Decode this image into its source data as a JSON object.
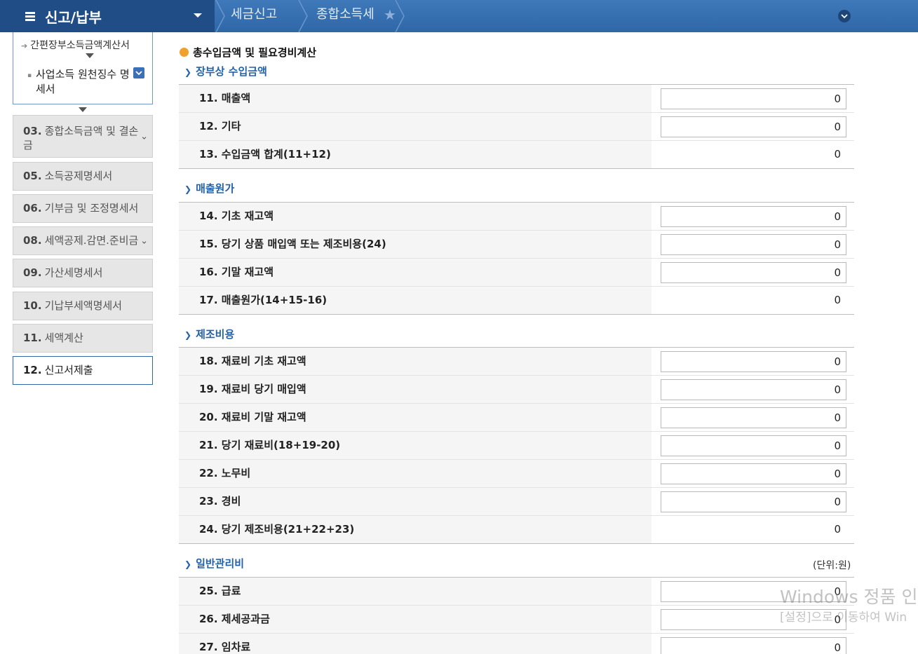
{
  "header": {
    "menu_title": "신고/납부",
    "breadcrumbs": [
      "세금신고",
      "종합소득세"
    ]
  },
  "sidebar": {
    "sub_items": [
      "간편장부소득금액계산서",
      "사업소득 원천징수 명세서"
    ],
    "nav": [
      {
        "num": "03.",
        "label": "종합소득금액 및 결손금"
      },
      {
        "num": "05.",
        "label": "소득공제명세서"
      },
      {
        "num": "06.",
        "label": "기부금 및 조정명세서"
      },
      {
        "num": "08.",
        "label": "세액공제.감면.준비금"
      },
      {
        "num": "09.",
        "label": "가산세명세서"
      },
      {
        "num": "10.",
        "label": "기납부세액명세서"
      },
      {
        "num": "11.",
        "label": "세액계산"
      },
      {
        "num": "12.",
        "label": "신고서제출"
      }
    ]
  },
  "main": {
    "title": "총수입금액 및 필요경비계산",
    "unit": "(단위:원)",
    "sections": [
      {
        "title": "장부상 수입금액",
        "rows": [
          {
            "label": "11. 매출액",
            "value": "0"
          },
          {
            "label": "12. 기타",
            "value": "0"
          },
          {
            "label": "13. 수입금액 합계(11+12)",
            "value": "0"
          }
        ]
      },
      {
        "title": "매출원가",
        "rows": [
          {
            "label": "14. 기초 재고액",
            "value": "0"
          },
          {
            "label": "15. 당기 상품 매입액 또는 제조비용(24)",
            "value": "0"
          },
          {
            "label": "16. 기말 재고액",
            "value": "0"
          },
          {
            "label": "17. 매출원가(14+15-16)",
            "value": "0"
          }
        ]
      },
      {
        "title": "제조비용",
        "rows": [
          {
            "label": "18. 재료비 기초 재고액",
            "value": "0"
          },
          {
            "label": "19. 재료비 당기 매입액",
            "value": "0"
          },
          {
            "label": "20. 재료비 기말 재고액",
            "value": "0"
          },
          {
            "label": "21. 당기 재료비(18+19-20)",
            "value": "0"
          },
          {
            "label": "22. 노무비",
            "value": "0"
          },
          {
            "label": "23. 경비",
            "value": "0"
          },
          {
            "label": "24. 당기 제조비용(21+22+23)",
            "value": "0"
          }
        ]
      },
      {
        "title": "일반관리비",
        "rows": [
          {
            "label": "25. 급료",
            "value": "0"
          },
          {
            "label": "26. 제세공과금",
            "value": "0"
          },
          {
            "label": "27. 임차료",
            "value": "0"
          }
        ]
      }
    ]
  },
  "watermark": {
    "line1": "Windows 정품 인",
    "line2": "[설정]으로 이동하여 Win"
  }
}
